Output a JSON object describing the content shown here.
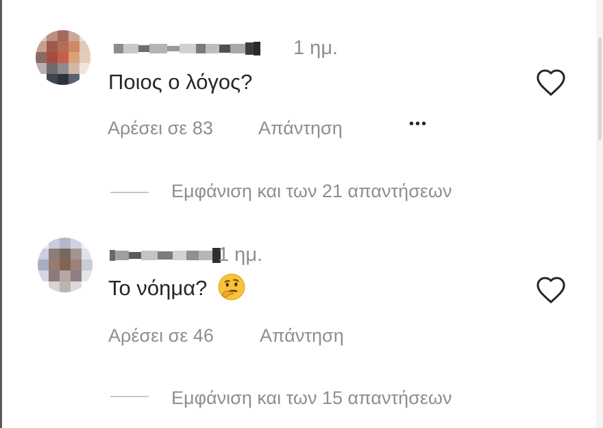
{
  "comments": [
    {
      "time": "1 ημ.",
      "text": "Ποιος ο λόγος?",
      "likes": "Αρέσει σε 83",
      "reply_label": "Απάντηση",
      "more_label": "•••",
      "view_replies": "Εμφάνιση και των 21 απαντήσεων",
      "icons": {
        "like": "heart-icon",
        "more": "more-options-icon"
      }
    },
    {
      "time": "1 ημ.",
      "text": "Το νόημα?",
      "emoji": "thinking-face-emoji",
      "likes": "Αρέσει σε 46",
      "reply_label": "Απάντηση",
      "view_replies": "Εμφάνιση και των 15 απαντήσεων",
      "icons": {
        "like": "heart-icon"
      }
    }
  ],
  "colors": {
    "primary_text": "#262626",
    "secondary_text": "#8e8e8e",
    "divider": "#c7c7c7",
    "background": "#ffffff"
  }
}
